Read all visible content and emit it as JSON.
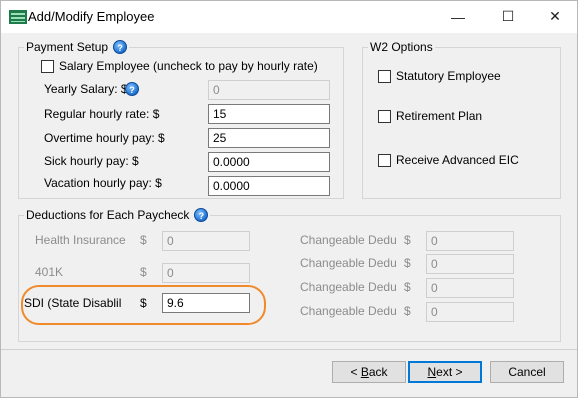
{
  "window": {
    "title": "Add/Modify Employee",
    "controls": {
      "minimize": "—",
      "maximize": "☐",
      "close": "✕"
    }
  },
  "payment_setup": {
    "legend": "Payment Setup",
    "help_icon": "help-icon",
    "salary_checkbox_label": "Salary Employee (uncheck to pay by hourly rate)",
    "salary_checked": false,
    "yearly_salary_label": "Yearly Salary: $",
    "yearly_salary_value": "0",
    "regular_hourly_label": "Regular hourly rate: $",
    "regular_hourly_value": "15",
    "overtime_label": "Overtime hourly pay: $",
    "overtime_value": "25",
    "sick_label": "Sick hourly pay: $",
    "sick_value": "0.0000",
    "vacation_label": "Vacation hourly pay: $",
    "vacation_value": "0.0000"
  },
  "w2_options": {
    "legend": "W2 Options",
    "statutory_label": "Statutory Employee",
    "retirement_label": "Retirement Plan",
    "advanced_eic_label": "Receive Advanced EIC"
  },
  "deductions": {
    "legend": "Deductions for Each Paycheck",
    "left_rows": [
      {
        "label": "Health Insurance",
        "currency": "$",
        "value": "0"
      },
      {
        "label": "401K",
        "currency": "$",
        "value": "0"
      },
      {
        "label": "SDI (State Disablil",
        "currency": "$",
        "value": "9.6"
      }
    ],
    "right_rows": [
      {
        "label": "Changeable Dedu",
        "currency": "$",
        "value": "0"
      },
      {
        "label": "Changeable Dedu",
        "currency": "$",
        "value": "0"
      },
      {
        "label": "Changeable Dedu",
        "currency": "$",
        "value": "0"
      },
      {
        "label": "Changeable Dedu",
        "currency": "$",
        "value": "0"
      }
    ]
  },
  "buttons": {
    "back_prefix": "< ",
    "back_mnemonic": "B",
    "back_rest": "ack",
    "next_mnemonic": "N",
    "next_rest": "ext >",
    "cancel": "Cancel"
  },
  "colors": {
    "highlight": "#f08a2c",
    "accent": "#0078d7"
  }
}
